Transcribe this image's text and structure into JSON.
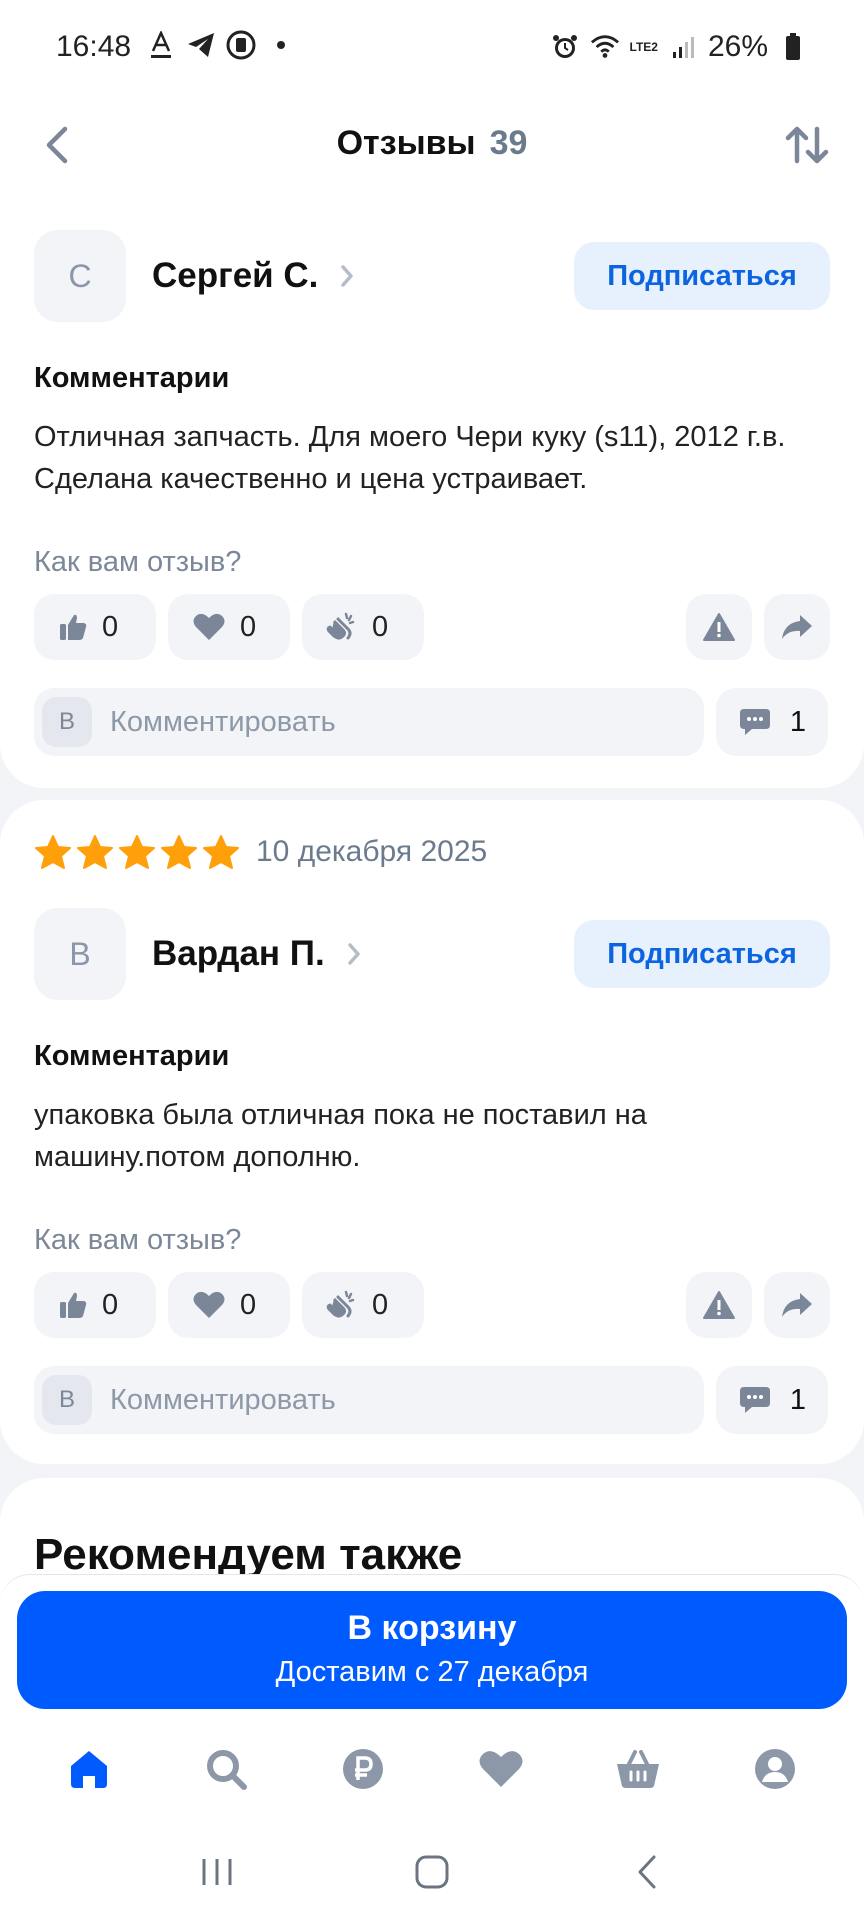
{
  "status_bar": {
    "time": "16:48",
    "battery": "26%",
    "lte_label": "LTE2"
  },
  "header": {
    "title": "Отзывы",
    "count": "39"
  },
  "reviews": [
    {
      "author_initial": "С",
      "author_name": "Сергей С.",
      "subscribe_label": "Подписаться",
      "section_label": "Комментарии",
      "text": "Отличная запчасть. Для моего Чери куку (s11), 2012 г.в. Сделана качественно и цена устраивает.",
      "rate_question": "Как вам отзыв?",
      "likes": "0",
      "hearts": "0",
      "claps": "0",
      "comment_avatar": "В",
      "comment_placeholder": "Комментировать",
      "comments_count": "1"
    },
    {
      "stars": 5,
      "date": "10 декабря 2025",
      "author_initial": "В",
      "author_name": "Вардан П.",
      "subscribe_label": "Подписаться",
      "section_label": "Комментарии",
      "text": "упаковка была отличная пока не поставил на машину.потом дополню.",
      "rate_question": "Как вам отзыв?",
      "likes": "0",
      "hearts": "0",
      "claps": "0",
      "comment_avatar": "В",
      "comment_placeholder": "Комментировать",
      "comments_count": "1"
    }
  ],
  "recommend": {
    "title": "Рекомендуем также"
  },
  "cart": {
    "label": "В корзину",
    "delivery": "Доставим с 27 декабря"
  },
  "bottom_nav": {
    "items": [
      "home-icon",
      "search-icon",
      "ruble-icon",
      "favorites-icon",
      "cart-icon",
      "profile-icon"
    ],
    "active_color": "#005bff",
    "inactive_color": "#8c98a8"
  },
  "colors": {
    "accent": "#005bff",
    "star": "#ff9f0a",
    "subscribe_bg": "#e6f1fd",
    "subscribe_text": "#0c64e0"
  }
}
